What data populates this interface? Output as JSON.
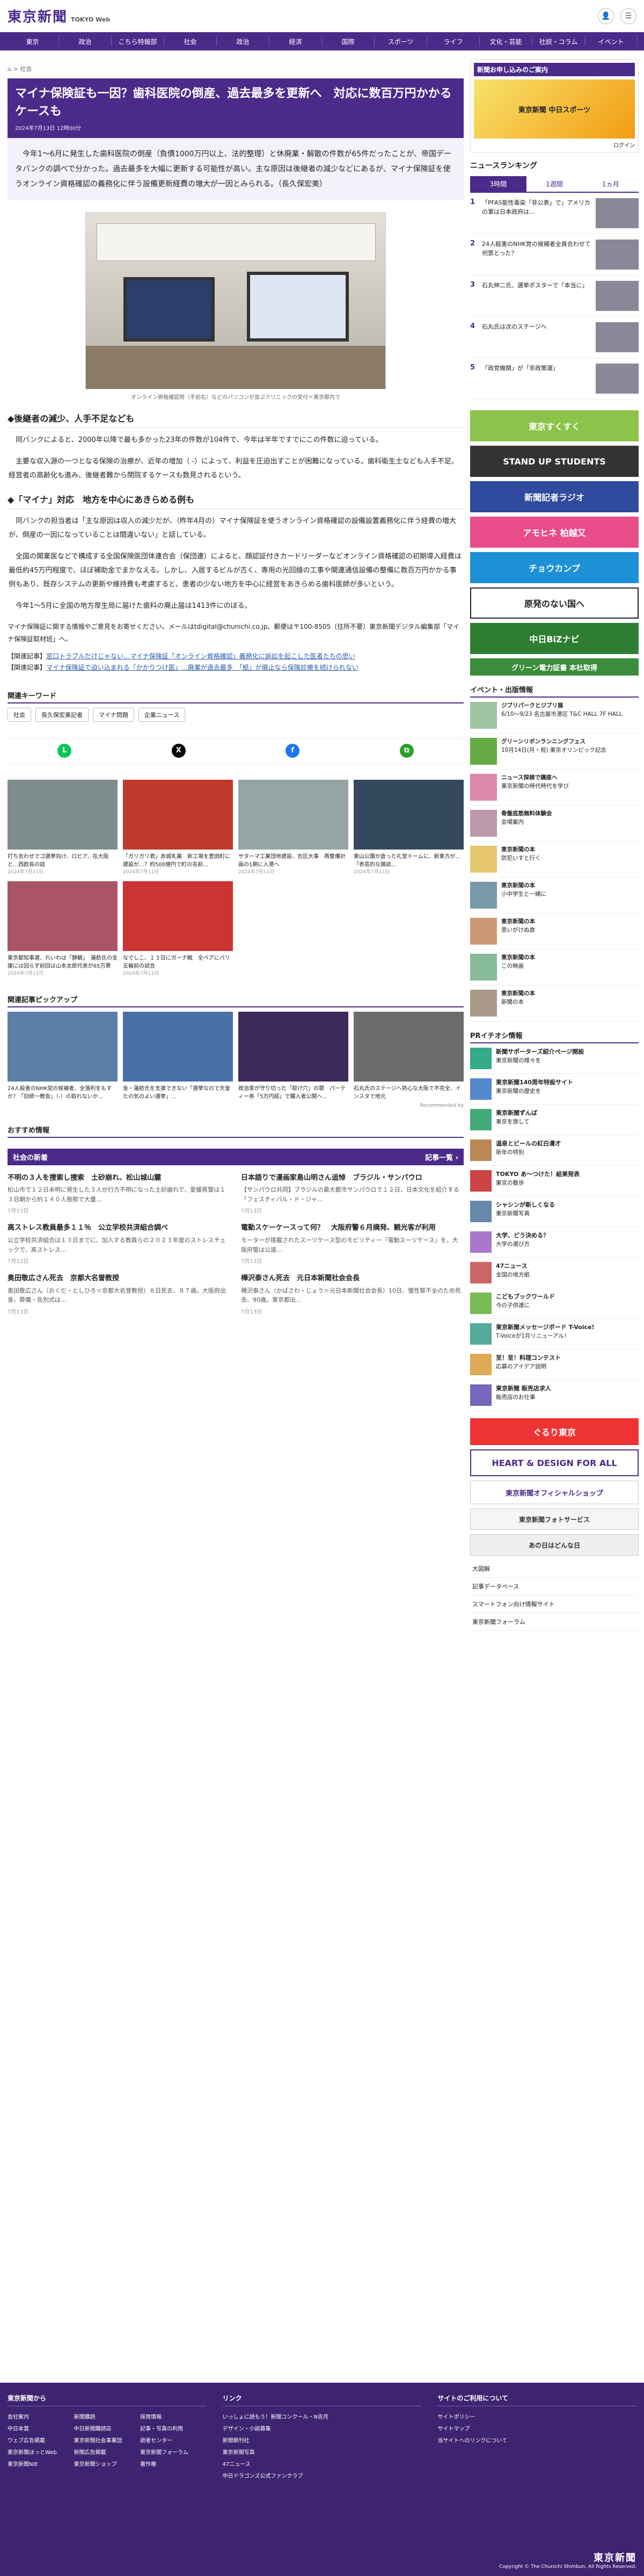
{
  "header": {
    "logo": "東京新聞",
    "logo_sub": "TOKYO Web",
    "login": "ログイン",
    "menu": "メニュー"
  },
  "nav": [
    "東京",
    "政治",
    "こちら特報部",
    "社会",
    "政治",
    "経済",
    "国際",
    "スポーツ",
    "ライフ",
    "文化・芸能",
    "社説・コラム",
    "イベント"
  ],
  "breadcrumb": "⌂ > 社会",
  "article": {
    "title": "マイナ保険証も一因？歯科医院の倒産、過去最多を更新へ　対応に数百万円かかるケースも",
    "date": "2024年7月13日 12時00分",
    "lead": "　今年1〜6月に発生した歯科医院の倒産（負債1000万円以上、法的整理）と休廃業・解散の件数が65件だったことが、帝国データバンクの調べで分かった。過去最多を大幅に更新する可能性が高い。主な原因は後継者の減少などにあるが、マイナ保険証を使うオンライン資格確認の義務化に伴う設備更新経費の増大が一因とみられる。（長久保宏美）",
    "caption": "オンライン資格確認用（手前右）などのパソコンが並ぶクリニックの受付＝東京都内で",
    "h2a": "◆後継者の減少、人手不足なども",
    "p1": "　同バンクによると、2000年以降で最も多かった23年の件数が104件で、今年は半年ですでにこの件数に迫っている。",
    "p2": "　主要な収入源の一つとなる保険の治療が、近年の増加（ -）によって、利益を圧迫出すことが困難になっている。歯科衛生士なども人手不足。経営者の高齢化も進み、後継者難から閉院するケースも数見されるという。",
    "h2b": "◆「マイナ」対応　地方を中心にあきらめる例も",
    "p3": "　同バンクの担当者は「主な原因は収入の減少だが、（昨年4月の）マイナ保険証を使うオンライン資格確認の設備設置義務化に伴う経費の増大が、倒産の一因になっていることは間違いない」と話している。",
    "p4": "　全国の開業医などで構成する全国保険医団体連合会（保団連）によると、顔認証付きカードリーダーなどオンライン資格確認の初期導入経費は最低約45万円程度で、ほぼ補助金でまかなえる。しかし、入居するビルが古く、専用の光回線の工事や関連通信設備の整備に数百万円かかる事例もあり、既存システムの更新や維持費も考慮すると、患者の少ない地方を中心に経営をあきらめる歯科医師が多いという。",
    "p5": "　今年1〜5月に全国の地方厚生局に届けた歯科の廃止届は1413件にのぼる。",
    "contact": "マイナ保険証に関する情報やご意見をお寄せください。メールはtdigital@chunichi.co.jp、郵便は〒100-8505（住所不要）東京新聞デジタル編集部「マイナ保険証取材班」へ。",
    "rel_label": "【関連記事】",
    "rel1": "窓口トラブルだけじゃない…マイナ保険証「オンライン資格確認」義務化に訴訟を起こした医者たちの思い",
    "rel2": "マイナ保険証で迫い込まれる「かかりつけ医」…廃業が過去最多　「紙」が廃止なら保険診療を続けられない"
  },
  "keywords": {
    "title": "関連キーワード",
    "items": [
      "社会",
      "長久保宏美記者",
      "マイナ問題",
      "企業ニュース"
    ]
  },
  "photos": [
    {
      "t": "打ち合わせでゴ選挙向け、ロビア、在大阪と…西欧長の話",
      "d": "2024年7月11日"
    },
    {
      "t": "「ガリガリ君」赤城乳業　新工場を豊田町に建設が…？約500億円で町の名前…",
      "d": "2024年7月11日"
    },
    {
      "t": "サターマ工業団地建設、吉区大事　再整備計画の1期に入港へ",
      "d": "2024年7月11日"
    },
    {
      "t": "東山公園が倉った礼堂ドームに、新東方が…「表芸的な雑誌…",
      "d": "2024年7月11日"
    },
    {
      "t": "東京都知事選、れいわは「静観」　蓮舫氏の支援には回らず前回は山本太郎代表が65万票",
      "d": "2024年7月11日"
    },
    {
      "t": "なでしこ、１３日にガーナ戦　全ペアにパリ五輪前の試合",
      "d": "2024年7月11日"
    }
  ],
  "pickup": {
    "title": "関連記事ピックアップ",
    "items": [
      "24人殺害のNHK党の候補者、全落利をもすか？「旧統一教会」（-）の取れないか…",
      "金・蓮舫氏を支援できない「選挙なので天皇たの気のよい選挙」…",
      "政治家が守り切った「取け穴」の罪　パーティー券「5万円超」で購入者公開へ…",
      "石丸氏のステージへ熱心な大阪で不完全、インスタで地元"
    ],
    "recommend": "Recommended by"
  },
  "osusume": "おすすめ情報",
  "society": {
    "title": "社会の新着",
    "more": "記事一覧 ›",
    "items": [
      {
        "h": "不明の３人を捜索し捜索　土砂崩れ、松山城山麓",
        "p": "松山市で１２日未明に発生した３人が行方不明になった土砂崩れで、愛媛県警は１３日朝から約１４０人態勢で大量…",
        "d": "7月13日"
      },
      {
        "h": "日本語りで漫画家島山明さん追悼　ブラジル・サンパウロ",
        "p": "【サンパウロ共同】ブラジルの最大都市サンパウロで１２日、日本文化を紹介する「フェスティバル・ド・ジャ…",
        "d": "7月13日"
      },
      {
        "h": "高ストレス教員最多１１％　公立学校共済組合調べ",
        "p": "公立学校共済組合は１３日までに、加入する教員らの２０２３年度のストレスチェックで、高ストレス…",
        "d": "7月13日"
      },
      {
        "h": "電動スケーケースって何？　大阪府警６月摘発、観光客が利用",
        "p": "モーターが搭載されたスーツケース型のモビリティー「電動スーツケース」を、大阪府警は公道…",
        "d": "7月13日"
      },
      {
        "h": "奥田敬広さん死去　京都大名誉教授",
        "p": "奥田敬広さん（おくだ・としひろ＝京都大名誉教授）８日死去、８７歳。大阪府出身。葬儀・告別式は…",
        "d": "7月13日"
      },
      {
        "h": "樺沢泰さん死去　元日本新聞社会会長",
        "p": "樺沢泰さん（かばさわ・じょう＝元日本新聞社会会長）10日、慢性腎不全のため死去、90歳。東京都出…",
        "d": "7月13日"
      }
    ]
  },
  "side": {
    "promo_hd": "新聞お申し込みのご案内",
    "promo1": "東京新聞 中日スポーツ",
    "promo2": "ログイン",
    "rank_title": "ニュースランキング",
    "rank_tabs": [
      "3時間",
      "1週間",
      "1ヵ月"
    ],
    "ranking": [
      "「PFAS能性毒染「非公表」で」アメリカの軍は日本政府は…",
      "24人殺害のNHK党の候補者全員合わせて何票とった？",
      "石丸伸二氏、選挙ポスターで「本当に」",
      "石丸氏は次のステージへ",
      "「政党機関」が「非政策運」"
    ],
    "banners": [
      "東京すくすく",
      "STAND UP STUDENTS",
      "新聞記者ラジオ",
      "アモヒネ 柏越又",
      "チョウカンプ",
      "原発のない国へ",
      "中日BiZナビ",
      "グリーン電力証書 本社取得"
    ],
    "events_title": "イベント・出版情報",
    "events": [
      {
        "t": "ジブリパークとジブリ展",
        "s": "6/10〜9/23 名古屋市港区 T&C HALL 7F HALL"
      },
      {
        "t": "グリーンリボンランニングフェス",
        "s": "10月14日(月・祝) 東京オリンピック記念"
      },
      {
        "t": "ニュース探検で講座へ",
        "s": "東京新聞の時代時代を学び"
      },
      {
        "t": "骨盤底筋無料体験会",
        "s": "会場案内"
      },
      {
        "t": "東京新聞の本",
        "s": "防犯いすと行く"
      },
      {
        "t": "東京新聞の本",
        "s": "小中学生と一緒に"
      },
      {
        "t": "東京新聞の本",
        "s": "思いがけぬ旅"
      },
      {
        "t": "東京新聞の本",
        "s": "この映画"
      },
      {
        "t": "東京新聞の本",
        "s": "新聞の本"
      }
    ],
    "pr_title": "PRイチオシ情報",
    "pr": [
      {
        "t": "新聞サポーターズ紹介ページ開設",
        "s": "東京新聞の様々を"
      },
      {
        "t": "東京新聞140周年特設サイト",
        "s": "東京新聞の歴史を"
      },
      {
        "t": "東京新聞ずんば",
        "s": "東京を旅して"
      },
      {
        "t": "温泉とビールの紅白漫才",
        "s": "新年の特別"
      },
      {
        "t": "TOKYO あ～つけた！結果発表",
        "s": "東京の散歩"
      },
      {
        "t": "シャシンが新しくなる",
        "s": "東京新聞写真"
      },
      {
        "t": "大学、どう決める？",
        "s": "大学の選び方"
      },
      {
        "t": "47ニュース",
        "s": "全国の地方紙"
      },
      {
        "t": "こどもブックワールド",
        "s": "今の子供達に"
      },
      {
        "t": "東京新聞メッセージボード T-Voice!",
        "s": "T-Voiceが1月リニューアル！"
      },
      {
        "t": "至！至！料理コンテスト",
        "s": "応募のアイデア説明"
      },
      {
        "t": "東京新聞 販売店求人",
        "s": "販売店のお仕事"
      }
    ],
    "bottom_banners": [
      "ぐるり東京",
      "HEART & DESIGN FOR ALL",
      "東京新聞オフィシャルショップ",
      "東京新聞フォトサービス",
      "あの日はどんな日"
    ],
    "links": [
      "大図解",
      "記事データベース",
      "スマートフォン向け情報サイト",
      "東京新聞フォーラム"
    ]
  },
  "footer": {
    "col1": "東京新聞から",
    "col1_items": [
      "会社案内",
      "新聞購読",
      "採用情報",
      "中日本賞",
      "中日新聞購読店",
      "記事・写真の利用",
      "ウェブ広告掲載",
      "東京新聞社会事業団",
      "読者センター",
      "東京新聞ほっとWeb",
      "新聞広告掲載",
      "東京新聞フォーラム",
      "東京新聞NIE",
      "東京新聞ショップ",
      "著作権"
    ],
    "col2": "リンク",
    "col2_items": [
      "いっしょに読もう！新聞コンクール・N吉月",
      "デザイン・小説募集",
      "新聞朝刊社",
      "東京新聞写真",
      "47ニュース",
      "中日ドラゴンズ公式ファンクラブ"
    ],
    "col3": "サイトのご利用について",
    "col3_items": [
      "サイトポリシー",
      "サイトマップ",
      "当サイトへのリンクについて"
    ],
    "copyright": "Copyright © The Chunichi Shimbun, All Rights Reserved."
  }
}
